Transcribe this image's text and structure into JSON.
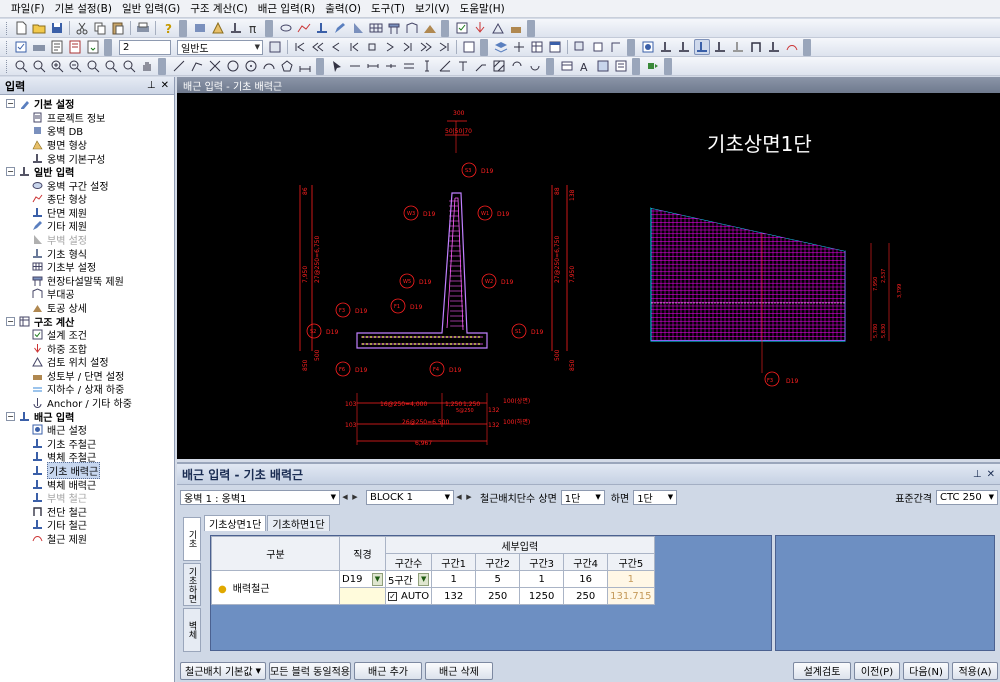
{
  "menu": [
    "파일(F)",
    "기본 설정(B)",
    "일반 입력(G)",
    "구조 계산(C)",
    "배근 입력(R)",
    "출력(O)",
    "도구(T)",
    "보기(V)",
    "도움말(H)"
  ],
  "toolbar2": {
    "layer_value": "2",
    "view_mode": "일반도"
  },
  "left_panel": {
    "title": "입력",
    "groups": [
      {
        "label": "기본 설정",
        "icon": "pencil-icon",
        "items": [
          {
            "label": "프로젝트 정보",
            "icon": "document-icon",
            "disabled": false,
            "selected": false
          },
          {
            "label": "옹벽 DB",
            "icon": "database-icon",
            "disabled": false,
            "selected": false
          },
          {
            "label": "평면 형상",
            "icon": "plan-icon",
            "disabled": false,
            "selected": false
          },
          {
            "label": "옹벽 기본구성",
            "icon": "wall-icon",
            "disabled": false,
            "selected": false
          }
        ]
      },
      {
        "label": "일반 입력",
        "icon": "wall-icon",
        "items": [
          {
            "label": "옹벽 구간 설정",
            "icon": "segment-icon",
            "disabled": false,
            "selected": false
          },
          {
            "label": "종단 형상",
            "icon": "profile-icon",
            "disabled": false,
            "selected": false
          },
          {
            "label": "단면 제원",
            "icon": "section-icon",
            "disabled": false,
            "selected": false
          },
          {
            "label": "기타 제원",
            "icon": "edit-icon",
            "disabled": false,
            "selected": false
          },
          {
            "label": "부벽 설정",
            "icon": "buttress-icon",
            "disabled": true,
            "selected": false
          },
          {
            "label": "기초 형식",
            "icon": "footing-icon",
            "disabled": false,
            "selected": false
          },
          {
            "label": "기초부 설정",
            "icon": "grid-icon",
            "disabled": false,
            "selected": false
          },
          {
            "label": "현장타설말뚝 제원",
            "icon": "pile-icon",
            "disabled": false,
            "selected": false
          },
          {
            "label": "부대공",
            "icon": "accessory-icon",
            "disabled": false,
            "selected": false
          },
          {
            "label": "토공 상세",
            "icon": "earth-icon",
            "disabled": false,
            "selected": false
          }
        ]
      },
      {
        "label": "구조 계산",
        "icon": "calc-icon",
        "items": [
          {
            "label": "설계 조건",
            "icon": "check-icon",
            "disabled": false,
            "selected": false
          },
          {
            "label": "하중 조합",
            "icon": "load-icon",
            "disabled": false,
            "selected": false
          },
          {
            "label": "검토 위치 설정",
            "icon": "position-icon",
            "disabled": false,
            "selected": false
          },
          {
            "label": "성토부 / 단면 설정",
            "icon": "fill-icon",
            "disabled": false,
            "selected": false
          },
          {
            "label": "지하수 / 상재 하중",
            "icon": "water-icon",
            "disabled": false,
            "selected": false
          },
          {
            "label": "Anchor / 기타 하중",
            "icon": "anchor-icon",
            "disabled": false,
            "selected": false
          }
        ]
      },
      {
        "label": "배근 입력",
        "icon": "rebar-icon",
        "items": [
          {
            "label": "배근 설정",
            "icon": "settings-icon",
            "disabled": false,
            "selected": false
          },
          {
            "label": "기초 주철근",
            "icon": "rebar-icon",
            "disabled": false,
            "selected": false
          },
          {
            "label": "벽체 주철근",
            "icon": "rebar-icon",
            "disabled": false,
            "selected": false
          },
          {
            "label": "기초 배력근",
            "icon": "rebar-icon",
            "disabled": false,
            "selected": true
          },
          {
            "label": "벽체 배력근",
            "icon": "rebar-icon",
            "disabled": false,
            "selected": false
          },
          {
            "label": "부벽 철근",
            "icon": "rebar-icon",
            "disabled": true,
            "selected": false
          },
          {
            "label": "전단 철근",
            "icon": "shear-icon",
            "disabled": false,
            "selected": false
          },
          {
            "label": "기타 철근",
            "icon": "rebar-icon",
            "disabled": false,
            "selected": false
          },
          {
            "label": "철근 제원",
            "icon": "spec-icon",
            "disabled": false,
            "selected": false
          }
        ]
      }
    ]
  },
  "drawing": {
    "title": "배근 입력 - 기초 배력근",
    "section_label": "기초상면1단",
    "dims": {
      "top_300": "300",
      "top_spacing": "50|50|70",
      "left_v1": "7,950",
      "left_v2": "27@250=6,750",
      "left_v3": "500",
      "left_v4": "850",
      "left_v5": "86",
      "right_v1": "7,950",
      "right_v2": "27@250=6,750",
      "right_v3": "500",
      "right_v4": "850",
      "right_v5": "88",
      "right_v6": "138",
      "b1": "103",
      "b2": "16@250=4,000",
      "b3": "1,250",
      "b4": "1,250",
      "b4b": "5@250",
      "b5": "132",
      "b6": "100(상면)",
      "b7": "103",
      "b8": "26@250=6,500",
      "b9": "132",
      "b10": "100(하면)",
      "b11": "6,967"
    },
    "labels": [
      "S3",
      "W3",
      "W1",
      "W5",
      "W2",
      "F3",
      "F1",
      "S2",
      "S1",
      "F6",
      "F4",
      "F3"
    ],
    "rebar_labels": [
      "D19",
      "D19",
      "D19",
      "D19",
      "D19",
      "D19",
      "D19",
      "D19",
      "D19",
      "D19",
      "D19",
      "D19"
    ],
    "plan_dims": [
      "7.950",
      "2,537",
      "3,799",
      "5,780",
      "5,830"
    ]
  },
  "bottom_panel": {
    "title": "배근 입력 - 기초 배력근",
    "wall_select": "옹벽 1 : 옹벽1",
    "block_select": "BLOCK  1",
    "top_layers_label": "철근배치단수 상면",
    "top_layers": "1단",
    "bottom_label": "하면",
    "bottom_layers": "1단",
    "spacing_label": "표준간격",
    "spacing": "CTC 250",
    "vtabs": [
      "기초",
      "기초하면",
      "벽체"
    ],
    "tabs": [
      "기초상면1단",
      "기초하면1단"
    ],
    "grid": {
      "col_category": "구분",
      "col_diameter": "직경",
      "col_detail": "세부입력",
      "col_sections": "구간수",
      "col_s1": "구간1",
      "col_s2": "구간2",
      "col_s3": "구간3",
      "col_s4": "구간4",
      "col_s5": "구간5",
      "row_name": "배력철근",
      "diameter": "D19",
      "sections": "5구간",
      "counts": [
        "1",
        "5",
        "1",
        "16",
        "1"
      ],
      "auto_label": "AUTO",
      "lengths": [
        "132",
        "250",
        "1250",
        "250",
        "131.715"
      ]
    },
    "buttons": {
      "default_rebar": "철근배치 기본값",
      "apply_all": "모든 블럭 동일적용",
      "add": "배근 추가",
      "delete": "배근 삭제",
      "design_check": "설계검토",
      "prev": "이전(P)",
      "next": "다음(N)",
      "apply": "적용(A)"
    }
  },
  "colors": {
    "drawing_bg": "#000000",
    "rebar_plan": "#ff00ff",
    "dim_red": "#ff2020",
    "wall_outline": "#c080ff"
  }
}
